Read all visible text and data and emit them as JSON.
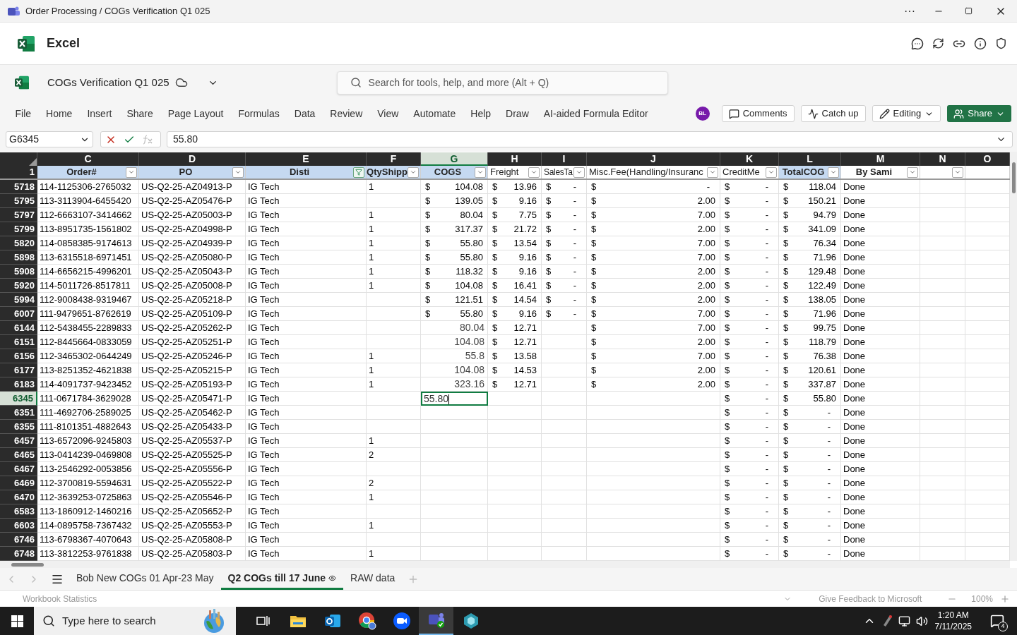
{
  "title_bar": {
    "title": "Order Processing / COGs Verification Q1 025",
    "more": "···"
  },
  "app_header": {
    "name": "Excel"
  },
  "file_bar": {
    "file_name": "COGs Verification Q1 025",
    "search": {
      "placeholder": "Search for tools, help, and more (Alt + Q)"
    }
  },
  "ribbon_tabs": [
    "File",
    "Home",
    "Insert",
    "Share",
    "Page Layout",
    "Formulas",
    "Data",
    "Review",
    "View",
    "Automate",
    "Help",
    "Draw",
    "AI-aided Formula Editor"
  ],
  "user": {
    "initials": "BL"
  },
  "actions": [
    {
      "label": "Comments",
      "kind": "comments"
    },
    {
      "label": "Catch up",
      "kind": "catchup"
    },
    {
      "label": "Editing",
      "kind": "editing"
    },
    {
      "label": "Share",
      "kind": "share"
    }
  ],
  "formula_bar": {
    "name_box": "G6345",
    "value": "55.80"
  },
  "sheet": {
    "columns": [
      {
        "letter": "C",
        "header": "Order#",
        "bold": true,
        "highlighted": true,
        "has_filter_button": true,
        "filtered": false,
        "selected": false
      },
      {
        "letter": "D",
        "header": "PO",
        "bold": true,
        "highlighted": true,
        "has_filter_button": true,
        "filtered": false,
        "selected": false
      },
      {
        "letter": "E",
        "header": "Disti",
        "bold": true,
        "highlighted": true,
        "has_filter_button": true,
        "filtered": true,
        "selected": false
      },
      {
        "letter": "F",
        "header": "QtyShipp",
        "bold": true,
        "highlighted": true,
        "has_filter_button": true,
        "filtered": false,
        "selected": false
      },
      {
        "letter": "G",
        "header": "COGS",
        "bold": true,
        "highlighted": true,
        "has_filter_button": true,
        "filtered": false,
        "selected": true
      },
      {
        "letter": "H",
        "header": "Freight",
        "bold": false,
        "highlighted": false,
        "has_filter_button": true,
        "filtered": false,
        "selected": false
      },
      {
        "letter": "I",
        "header": "SalesTa",
        "bold": false,
        "highlighted": false,
        "has_filter_button": true,
        "filtered": false,
        "selected": false
      },
      {
        "letter": "J",
        "header": "Misc.Fee(Handling/Insuranc",
        "bold": false,
        "highlighted": false,
        "has_filter_button": true,
        "filtered": false,
        "selected": false
      },
      {
        "letter": "K",
        "header": "CreditMe",
        "bold": false,
        "highlighted": false,
        "has_filter_button": true,
        "filtered": false,
        "selected": false
      },
      {
        "letter": "L",
        "header": "TotalCOG",
        "bold": true,
        "highlighted": true,
        "has_filter_button": true,
        "filtered": false,
        "selected": false
      },
      {
        "letter": "M",
        "header": "By Sami",
        "bold": true,
        "highlighted": false,
        "has_filter_button": true,
        "filtered": false,
        "selected": false
      },
      {
        "letter": "N",
        "highlighted": false,
        "has_filter_button": true,
        "filtered": false,
        "selected": false
      },
      {
        "letter": "O",
        "highlighted": false,
        "has_filter_button": false,
        "selected": false
      }
    ],
    "header_row_number": "1",
    "rows": [
      {
        "number": "5718",
        "selected": false,
        "order": "114-1125306-2765032",
        "po": "US-Q2-25-AZ04913-P",
        "disti": "IG Tech",
        "qty": "1",
        "cogs": {
          "symbol": "$",
          "amount": "104.08"
        },
        "freight": {
          "symbol": "$",
          "amount": "13.96"
        },
        "sales_tax": {
          "symbol": "$",
          "amount": "-"
        },
        "misc_fee": {
          "symbol": "$",
          "amount": "-"
        },
        "credit_memo": {
          "symbol": "$",
          "amount": "-"
        },
        "total_cogs": {
          "symbol": "$",
          "amount": "118.04"
        },
        "by_sami": "Done"
      },
      {
        "number": "5795",
        "selected": false,
        "order": "113-3113904-6455420",
        "po": "US-Q2-25-AZ05476-P",
        "disti": "IG Tech",
        "cogs": {
          "symbol": "$",
          "amount": "139.05"
        },
        "freight": {
          "symbol": "$",
          "amount": "9.16"
        },
        "sales_tax": {
          "symbol": "$",
          "amount": "-"
        },
        "misc_fee": {
          "symbol": "$",
          "amount": "2.00"
        },
        "credit_memo": {
          "symbol": "$",
          "amount": "-"
        },
        "total_cogs": {
          "symbol": "$",
          "amount": "150.21"
        },
        "by_sami": "Done"
      },
      {
        "number": "5797",
        "selected": false,
        "order": "112-6663107-3414662",
        "po": "US-Q2-25-AZ05003-P",
        "disti": "IG Tech",
        "qty": "1",
        "cogs": {
          "symbol": "$",
          "amount": "80.04"
        },
        "freight": {
          "symbol": "$",
          "amount": "7.75"
        },
        "sales_tax": {
          "symbol": "$",
          "amount": "-"
        },
        "misc_fee": {
          "symbol": "$",
          "amount": "7.00"
        },
        "credit_memo": {
          "symbol": "$",
          "amount": "-"
        },
        "total_cogs": {
          "symbol": "$",
          "amount": "94.79"
        },
        "by_sami": "Done"
      },
      {
        "number": "5799",
        "selected": false,
        "order": "113-8951735-1561802",
        "po": "US-Q2-25-AZ04998-P",
        "disti": "IG Tech",
        "qty": "1",
        "cogs": {
          "symbol": "$",
          "amount": "317.37"
        },
        "freight": {
          "symbol": "$",
          "amount": "21.72"
        },
        "sales_tax": {
          "symbol": "$",
          "amount": "-"
        },
        "misc_fee": {
          "symbol": "$",
          "amount": "2.00"
        },
        "credit_memo": {
          "symbol": "$",
          "amount": "-"
        },
        "total_cogs": {
          "symbol": "$",
          "amount": "341.09"
        },
        "by_sami": "Done"
      },
      {
        "number": "5820",
        "selected": false,
        "order": "114-0858385-9174613",
        "po": "US-Q2-25-AZ04939-P",
        "disti": "IG Tech",
        "qty": "1",
        "cogs": {
          "symbol": "$",
          "amount": "55.80"
        },
        "freight": {
          "symbol": "$",
          "amount": "13.54"
        },
        "sales_tax": {
          "symbol": "$",
          "amount": "-"
        },
        "misc_fee": {
          "symbol": "$",
          "amount": "7.00"
        },
        "credit_memo": {
          "symbol": "$",
          "amount": "-"
        },
        "total_cogs": {
          "symbol": "$",
          "amount": "76.34"
        },
        "by_sami": "Done"
      },
      {
        "number": "5898",
        "selected": false,
        "order": "113-6315518-6971451",
        "po": "US-Q2-25-AZ05080-P",
        "disti": "IG Tech",
        "qty": "1",
        "cogs": {
          "symbol": "$",
          "amount": "55.80"
        },
        "freight": {
          "symbol": "$",
          "amount": "9.16"
        },
        "sales_tax": {
          "symbol": "$",
          "amount": "-"
        },
        "misc_fee": {
          "symbol": "$",
          "amount": "7.00"
        },
        "credit_memo": {
          "symbol": "$",
          "amount": "-"
        },
        "total_cogs": {
          "symbol": "$",
          "amount": "71.96"
        },
        "by_sami": "Done"
      },
      {
        "number": "5908",
        "selected": false,
        "order": "114-6656215-4996201",
        "po": "US-Q2-25-AZ05043-P",
        "disti": "IG Tech",
        "qty": "1",
        "cogs": {
          "symbol": "$",
          "amount": "118.32"
        },
        "freight": {
          "symbol": "$",
          "amount": "9.16"
        },
        "sales_tax": {
          "symbol": "$",
          "amount": "-"
        },
        "misc_fee": {
          "symbol": "$",
          "amount": "2.00"
        },
        "credit_memo": {
          "symbol": "$",
          "amount": "-"
        },
        "total_cogs": {
          "symbol": "$",
          "amount": "129.48"
        },
        "by_sami": "Done"
      },
      {
        "number": "5920",
        "selected": false,
        "order": "114-5011726-8517811",
        "po": "US-Q2-25-AZ05008-P",
        "disti": "IG Tech",
        "qty": "1",
        "cogs": {
          "symbol": "$",
          "amount": "104.08"
        },
        "freight": {
          "symbol": "$",
          "amount": "16.41"
        },
        "sales_tax": {
          "symbol": "$",
          "amount": "-"
        },
        "misc_fee": {
          "symbol": "$",
          "amount": "2.00"
        },
        "credit_memo": {
          "symbol": "$",
          "amount": "-"
        },
        "total_cogs": {
          "symbol": "$",
          "amount": "122.49"
        },
        "by_sami": "Done"
      },
      {
        "number": "5994",
        "selected": false,
        "order": "112-9008438-9319467",
        "po": "US-Q2-25-AZ05218-P",
        "disti": "IG Tech",
        "cogs": {
          "symbol": "$",
          "amount": "121.51"
        },
        "freight": {
          "symbol": "$",
          "amount": "14.54"
        },
        "sales_tax": {
          "symbol": "$",
          "amount": "-"
        },
        "misc_fee": {
          "symbol": "$",
          "amount": "2.00"
        },
        "credit_memo": {
          "symbol": "$",
          "amount": "-"
        },
        "total_cogs": {
          "symbol": "$",
          "amount": "138.05"
        },
        "by_sami": "Done"
      },
      {
        "number": "6007",
        "selected": false,
        "order": "111-9479651-8762619",
        "po": "US-Q2-25-AZ05109-P",
        "disti": "IG Tech",
        "cogs": {
          "symbol": "$",
          "amount": "55.80"
        },
        "freight": {
          "symbol": "$",
          "amount": "9.16"
        },
        "sales_tax": {
          "symbol": "$",
          "amount": "-"
        },
        "misc_fee": {
          "symbol": "$",
          "amount": "7.00"
        },
        "credit_memo": {
          "symbol": "$",
          "amount": "-"
        },
        "total_cogs": {
          "symbol": "$",
          "amount": "71.96"
        },
        "by_sami": "Done"
      },
      {
        "number": "6144",
        "selected": false,
        "order": "112-5438455-2289833",
        "po": "US-Q2-25-AZ05262-P",
        "disti": "IG Tech",
        "cogs": "80.04",
        "freight": {
          "symbol": "$",
          "amount": "12.71"
        },
        "misc_fee": {
          "symbol": "$",
          "amount": "7.00"
        },
        "credit_memo": {
          "symbol": "$",
          "amount": "-"
        },
        "total_cogs": {
          "symbol": "$",
          "amount": "99.75"
        },
        "by_sami": "Done"
      },
      {
        "number": "6151",
        "selected": false,
        "order": "112-8445664-0833059",
        "po": "US-Q2-25-AZ05251-P",
        "disti": "IG Tech",
        "cogs": "104.08",
        "freight": {
          "symbol": "$",
          "amount": "12.71"
        },
        "misc_fee": {
          "symbol": "$",
          "amount": "2.00"
        },
        "credit_memo": {
          "symbol": "$",
          "amount": "-"
        },
        "total_cogs": {
          "symbol": "$",
          "amount": "118.79"
        },
        "by_sami": "Done"
      },
      {
        "number": "6156",
        "selected": false,
        "order": "112-3465302-0644249",
        "po": "US-Q2-25-AZ05246-P",
        "disti": "IG Tech",
        "qty": "1",
        "cogs": "55.8",
        "freight": {
          "symbol": "$",
          "amount": "13.58"
        },
        "misc_fee": {
          "symbol": "$",
          "amount": "7.00"
        },
        "credit_memo": {
          "symbol": "$",
          "amount": "-"
        },
        "total_cogs": {
          "symbol": "$",
          "amount": "76.38"
        },
        "by_sami": "Done"
      },
      {
        "number": "6177",
        "selected": false,
        "order": "113-8251352-4621838",
        "po": "US-Q2-25-AZ05215-P",
        "disti": "IG Tech",
        "qty": "1",
        "cogs": "104.08",
        "freight": {
          "symbol": "$",
          "amount": "14.53"
        },
        "misc_fee": {
          "symbol": "$",
          "amount": "2.00"
        },
        "credit_memo": {
          "symbol": "$",
          "amount": "-"
        },
        "total_cogs": {
          "symbol": "$",
          "amount": "120.61"
        },
        "by_sami": "Done"
      },
      {
        "number": "6183",
        "selected": false,
        "order": "114-4091737-9423452",
        "po": "US-Q2-25-AZ05193-P",
        "disti": "IG Tech",
        "qty": "1",
        "cogs": "323.16",
        "freight": {
          "symbol": "$",
          "amount": "12.71"
        },
        "misc_fee": {
          "symbol": "$",
          "amount": "2.00"
        },
        "credit_memo": {
          "symbol": "$",
          "amount": "-"
        },
        "total_cogs": {
          "symbol": "$",
          "amount": "337.87"
        },
        "by_sami": "Done"
      },
      {
        "number": "6345",
        "selected": true,
        "order": "111-0671784-3629028",
        "po": "US-Q2-25-AZ05471-P",
        "disti": "IG Tech",
        "cogs": "55.80",
        "credit_memo": {
          "symbol": "$",
          "amount": "-"
        },
        "total_cogs": {
          "symbol": "$",
          "amount": "55.80"
        },
        "by_sami": "Done"
      },
      {
        "number": "6351",
        "selected": false,
        "order": "111-4692706-2589025",
        "po": "US-Q2-25-AZ05462-P",
        "disti": "IG Tech",
        "credit_memo": {
          "symbol": "$",
          "amount": "-"
        },
        "total_cogs": {
          "symbol": "$",
          "amount": "-"
        },
        "by_sami": "Done"
      },
      {
        "number": "6355",
        "selected": false,
        "order": "111-8101351-4882643",
        "po": "US-Q2-25-AZ05433-P",
        "disti": "IG Tech",
        "credit_memo": {
          "symbol": "$",
          "amount": "-"
        },
        "total_cogs": {
          "symbol": "$",
          "amount": "-"
        },
        "by_sami": "Done"
      },
      {
        "number": "6457",
        "selected": false,
        "order": "113-6572096-9245803",
        "po": "US-Q2-25-AZ05537-P",
        "disti": "IG Tech",
        "qty": "1",
        "credit_memo": {
          "symbol": "$",
          "amount": "-"
        },
        "total_cogs": {
          "symbol": "$",
          "amount": "-"
        },
        "by_sami": "Done"
      },
      {
        "number": "6465",
        "selected": false,
        "order": "113-0414239-0469808",
        "po": "US-Q2-25-AZ05525-P",
        "disti": "IG Tech",
        "qty": "2",
        "credit_memo": {
          "symbol": "$",
          "amount": "-"
        },
        "total_cogs": {
          "symbol": "$",
          "amount": "-"
        },
        "by_sami": "Done"
      },
      {
        "number": "6467",
        "selected": false,
        "order": "113-2546292-0053856",
        "po": "US-Q2-25-AZ05556-P",
        "disti": "IG Tech",
        "credit_memo": {
          "symbol": "$",
          "amount": "-"
        },
        "total_cogs": {
          "symbol": "$",
          "amount": "-"
        },
        "by_sami": "Done"
      },
      {
        "number": "6469",
        "selected": false,
        "order": "112-3700819-5594631",
        "po": "US-Q2-25-AZ05522-P",
        "disti": "IG Tech",
        "qty": "2",
        "credit_memo": {
          "symbol": "$",
          "amount": "-"
        },
        "total_cogs": {
          "symbol": "$",
          "amount": "-"
        },
        "by_sami": "Done"
      },
      {
        "number": "6470",
        "selected": false,
        "order": "112-3639253-0725863",
        "po": "US-Q2-25-AZ05546-P",
        "disti": "IG Tech",
        "qty": "1",
        "credit_memo": {
          "symbol": "$",
          "amount": "-"
        },
        "total_cogs": {
          "symbol": "$",
          "amount": "-"
        },
        "by_sami": "Done"
      },
      {
        "number": "6583",
        "selected": false,
        "order": "113-1860912-1460216",
        "po": "US-Q2-25-AZ05652-P",
        "disti": "IG Tech",
        "credit_memo": {
          "symbol": "$",
          "amount": "-"
        },
        "total_cogs": {
          "symbol": "$",
          "amount": "-"
        },
        "by_sami": "Done"
      },
      {
        "number": "6603",
        "selected": false,
        "order": "114-0895758-7367432",
        "po": "US-Q2-25-AZ05553-P",
        "disti": "IG Tech",
        "qty": "1",
        "credit_memo": {
          "symbol": "$",
          "amount": "-"
        },
        "total_cogs": {
          "symbol": "$",
          "amount": "-"
        },
        "by_sami": "Done"
      },
      {
        "number": "6746",
        "selected": false,
        "order": "113-6798367-4070643",
        "po": "US-Q2-25-AZ05808-P",
        "disti": "IG Tech",
        "credit_memo": {
          "symbol": "$",
          "amount": "-"
        },
        "total_cogs": {
          "symbol": "$",
          "amount": "-"
        },
        "by_sami": "Done"
      },
      {
        "number": "6748",
        "selected": false,
        "order": "113-3812253-9761838",
        "po": "US-Q2-25-AZ05803-P",
        "disti": "IG Tech",
        "qty": "1",
        "credit_memo": {
          "symbol": "$",
          "amount": "-"
        },
        "total_cogs": {
          "symbol": "$",
          "amount": "-"
        },
        "by_sami": "Done"
      }
    ]
  },
  "sheet_tabs": [
    {
      "label": "Bob New COGs 01 Apr-23 May",
      "selected": false
    },
    {
      "label": "Q2 COGs till 17 June",
      "selected": true
    },
    {
      "label": "RAW data",
      "selected": false
    }
  ],
  "status_bar": {
    "statistics": "Workbook Statistics",
    "feedback": "Give Feedback to Microsoft",
    "zoom": "100%"
  },
  "taskbar": {
    "search": {
      "placeholder": "Type here to search"
    },
    "time": "1:20 AM",
    "date": "7/11/2025",
    "notifications": "4"
  }
}
